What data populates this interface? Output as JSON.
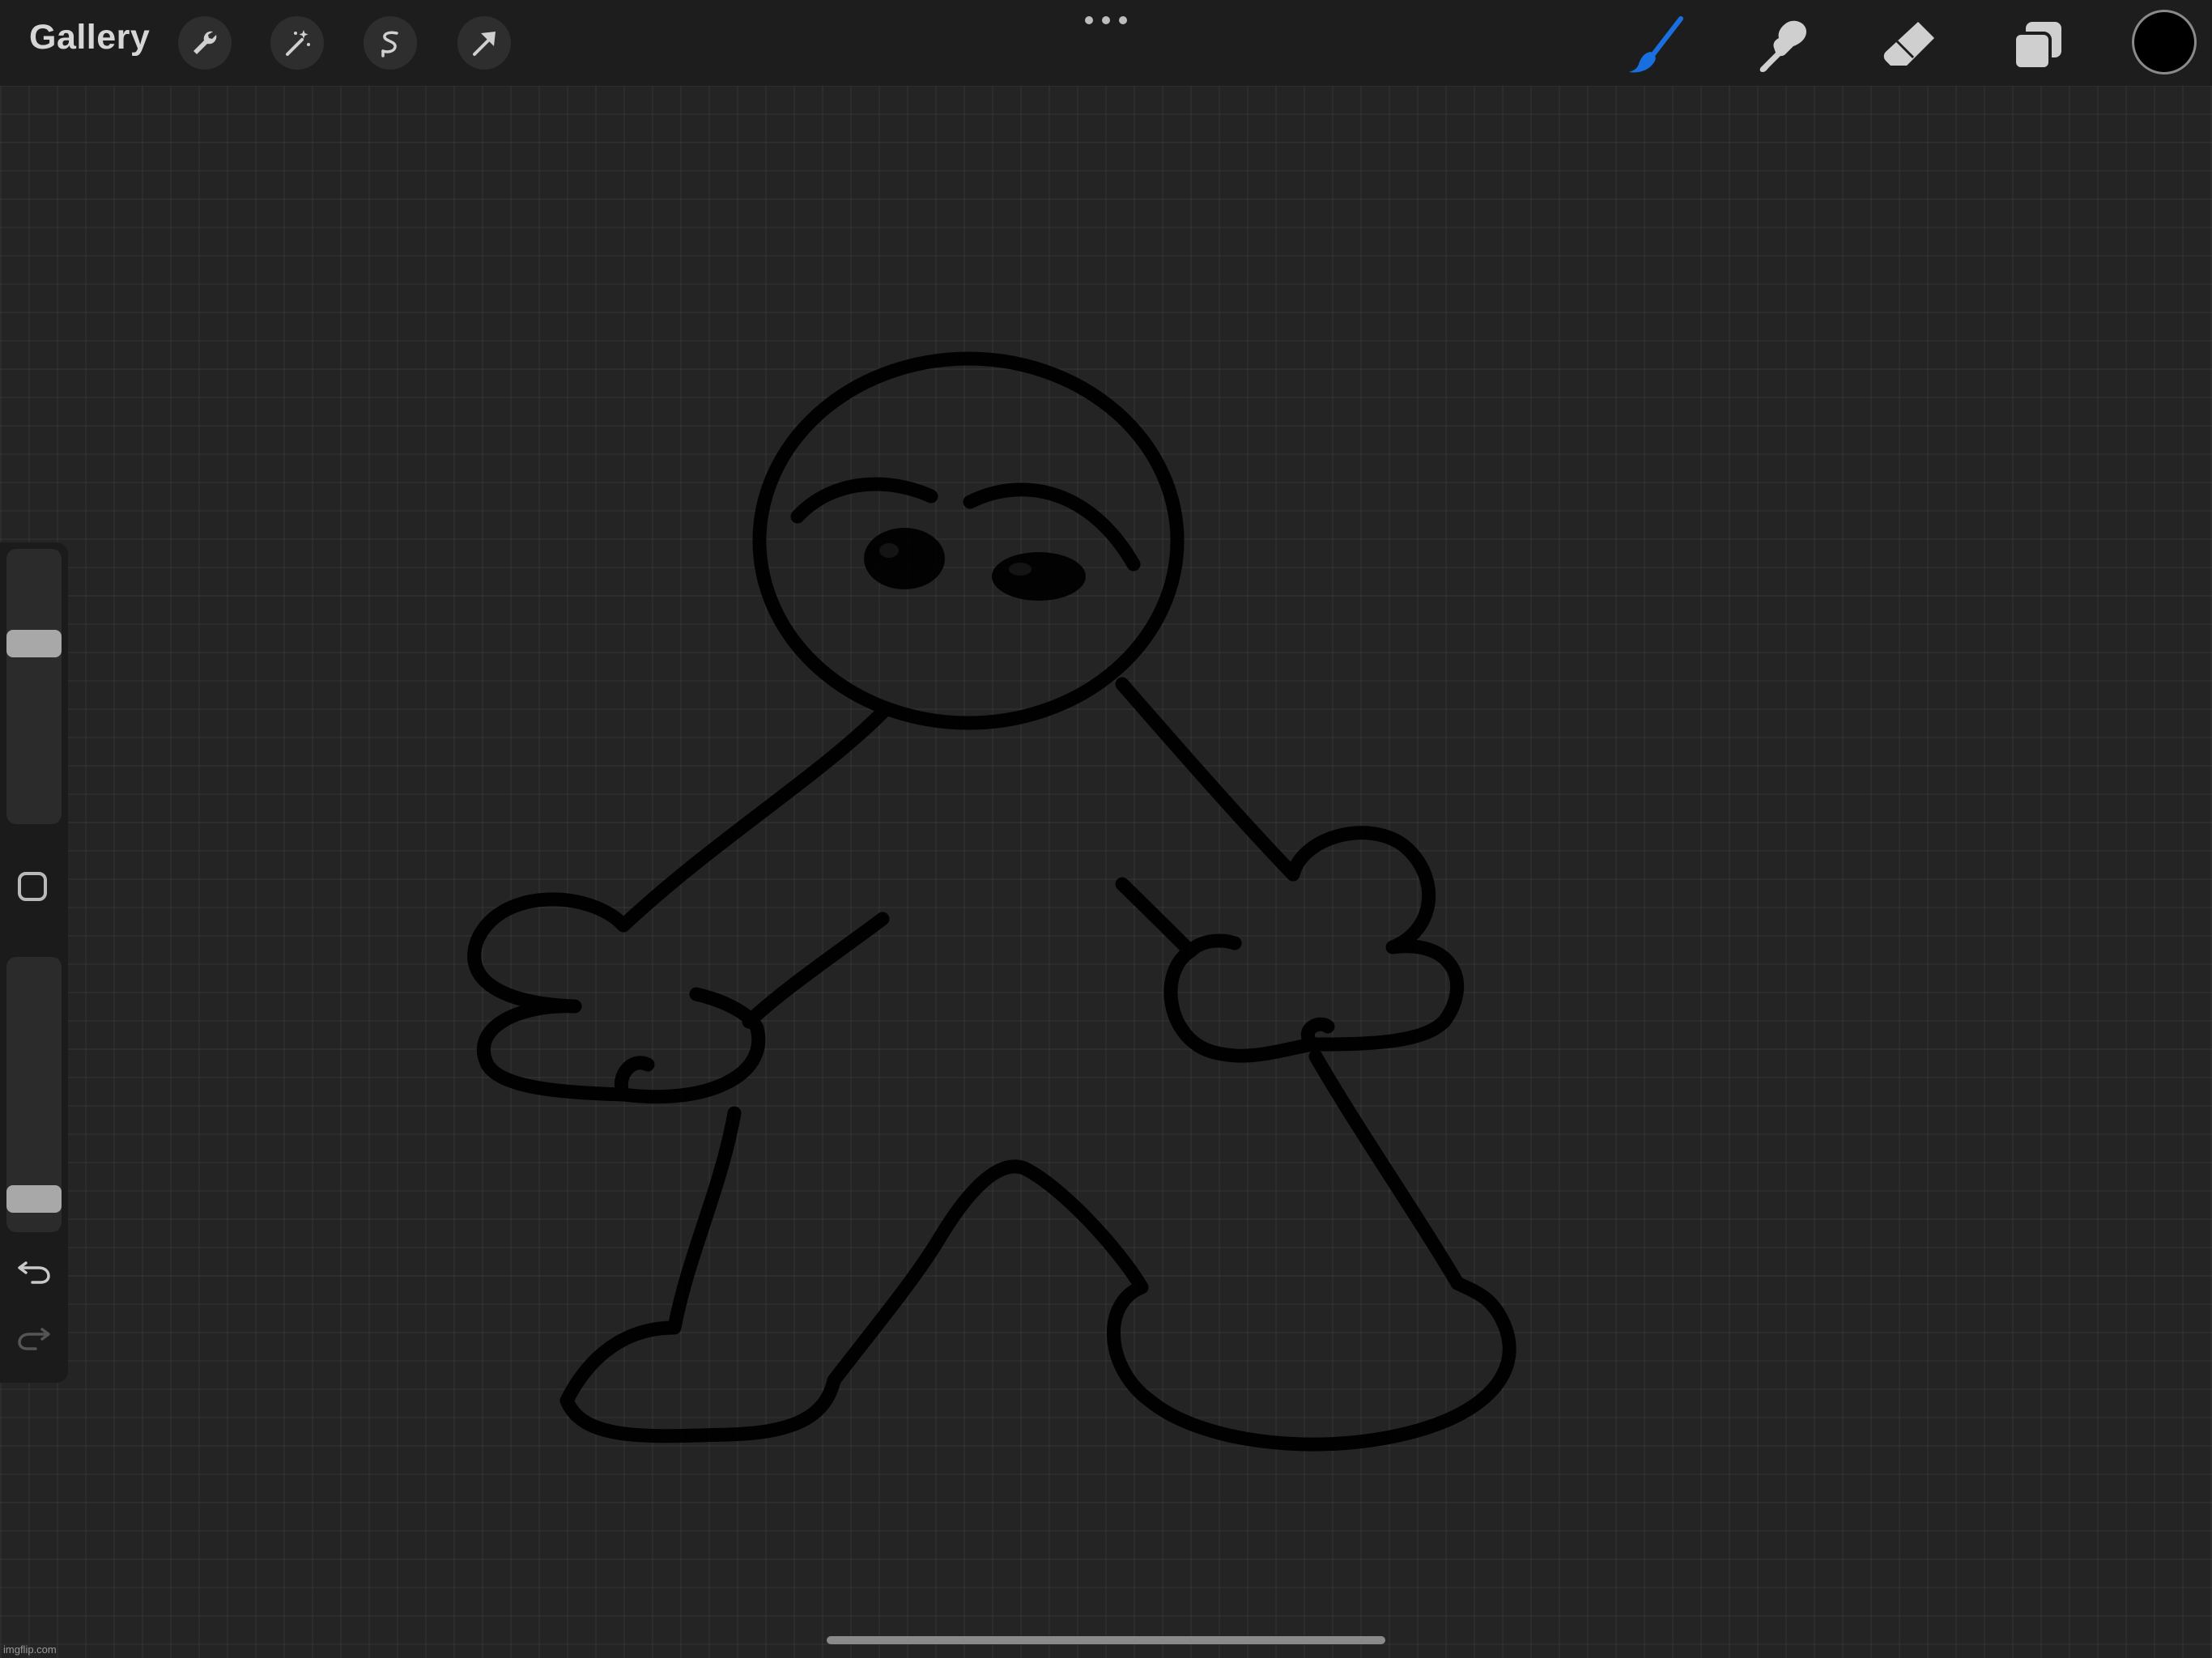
{
  "toolbar": {
    "gallery_label": "Gallery",
    "left_tools": [
      "wrench-icon",
      "magic-wand-icon",
      "selection-icon",
      "transform-arrow-icon"
    ],
    "right_tools": [
      "brush-icon",
      "smudge-icon",
      "eraser-icon",
      "layers-icon"
    ],
    "active_tool": "brush",
    "accent_color": "#1a6fe0",
    "current_color": "#000000"
  },
  "sidebar": {
    "brush_size_level": 0.68,
    "opacity_level": 0.06,
    "buttons": [
      "modify-square",
      "undo-icon",
      "redo-icon"
    ]
  },
  "canvas": {
    "background": "#242424",
    "grid": true,
    "drawing": "stick figure sketch"
  },
  "watermark": "imgflip.com"
}
